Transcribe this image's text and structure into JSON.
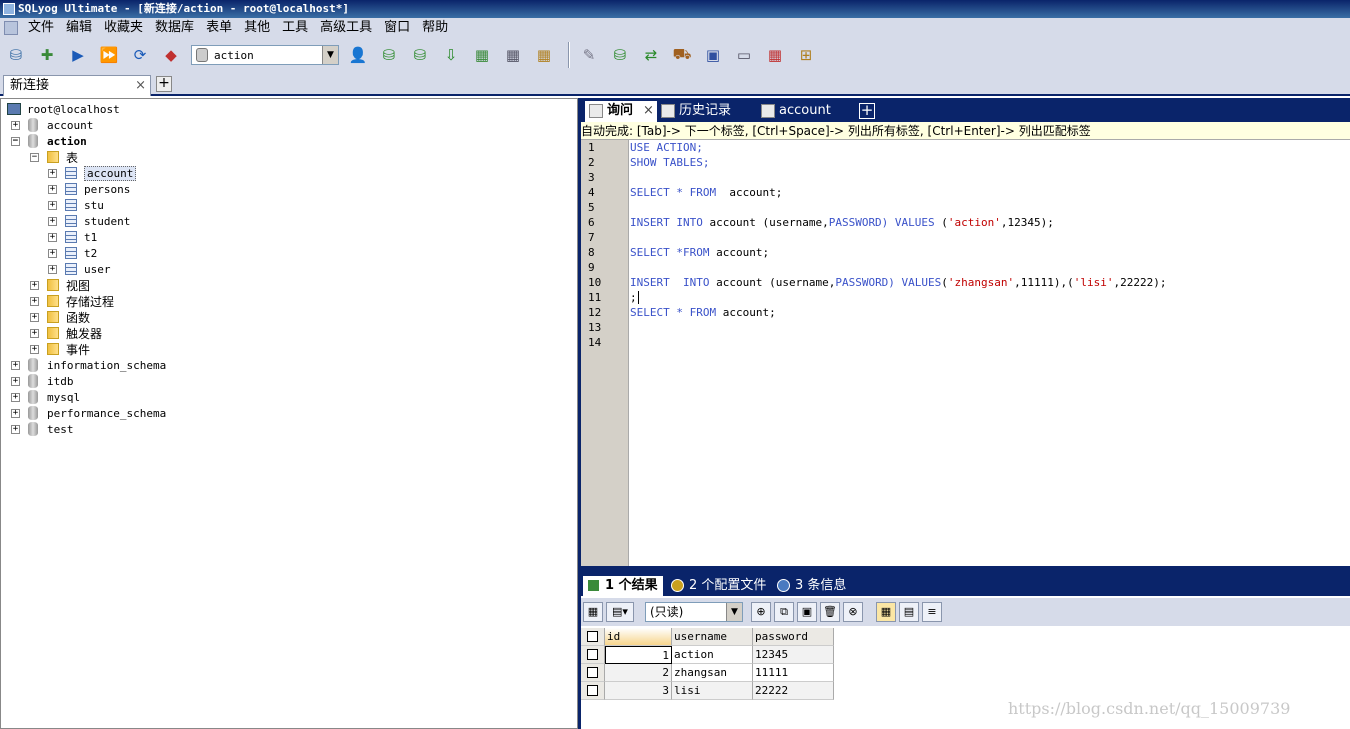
{
  "window": {
    "title": "SQLyog Ultimate - [新连接/action - root@localhost*]"
  },
  "menu": [
    "文件",
    "编辑",
    "收藏夹",
    "数据库",
    "表单",
    "其他",
    "工具",
    "高级工具",
    "窗口",
    "帮助"
  ],
  "toolbar": {
    "database_select": "action"
  },
  "connection_tab": {
    "label": "新连接",
    "close": "×",
    "add": "+"
  },
  "tree": {
    "server": "root@localhost",
    "db_account": "account",
    "db_action": "action",
    "folder_tables": "表",
    "tables": [
      "account",
      "persons",
      "stu",
      "student",
      "t1",
      "t2",
      "user"
    ],
    "folders": [
      "视图",
      "存储过程",
      "函数",
      "触发器",
      "事件"
    ],
    "other_dbs": [
      "information_schema",
      "itdb",
      "mysql",
      "performance_schema",
      "test"
    ]
  },
  "query_tabs": [
    {
      "label": "询问",
      "close": "×"
    },
    {
      "label": "历史记录"
    },
    {
      "label": "account"
    }
  ],
  "query_add": "+",
  "hint": "自动完成: [Tab]-> 下一个标签, [Ctrl+Space]-> 列出所有标签, [Ctrl+Enter]-> 列出匹配标签",
  "line_numbers": [
    "1",
    "2",
    "3",
    "4",
    "5",
    "6",
    "7",
    "8",
    "9",
    "10",
    "11",
    "12",
    "13",
    "14"
  ],
  "code": {
    "l1": "USE ACTION;",
    "l2": "SHOW TABLES;",
    "l4a": "SELECT * FROM",
    "l4b": "  account;",
    "l6a": "INSERT INTO",
    "l6b": " account (username,",
    "l6c": "PASSWORD) VALUES",
    "l6d": " (",
    "l6e": "'action'",
    "l6f": ",12345);",
    "l8a": "SELECT *FROM",
    "l8b": " account;",
    "l10a": "INSERT  INTO",
    "l10b": " account (username,",
    "l10c": "PASSWORD) VALUES",
    "l10d": "(",
    "l10e": "'zhangsan'",
    "l10f": ",11111),(",
    "l10g": "'lisi'",
    "l10h": ",22222);",
    "l11": ";",
    "l12a": "SELECT * FROM",
    "l12b": " account;"
  },
  "result_tabs": [
    {
      "label": "1 个结果"
    },
    {
      "label": "2 个配置文件"
    },
    {
      "label": "3 条信息"
    }
  ],
  "result_mode": "(只读)",
  "results": {
    "columns": [
      "id",
      "username",
      "password"
    ],
    "rows": [
      {
        "id": "1",
        "username": "action",
        "password": "12345"
      },
      {
        "id": "2",
        "username": "zhangsan",
        "password": "11111"
      },
      {
        "id": "3",
        "username": "lisi",
        "password": "22222"
      }
    ]
  },
  "watermark": "https://blog.csdn.net/qq_15009739"
}
